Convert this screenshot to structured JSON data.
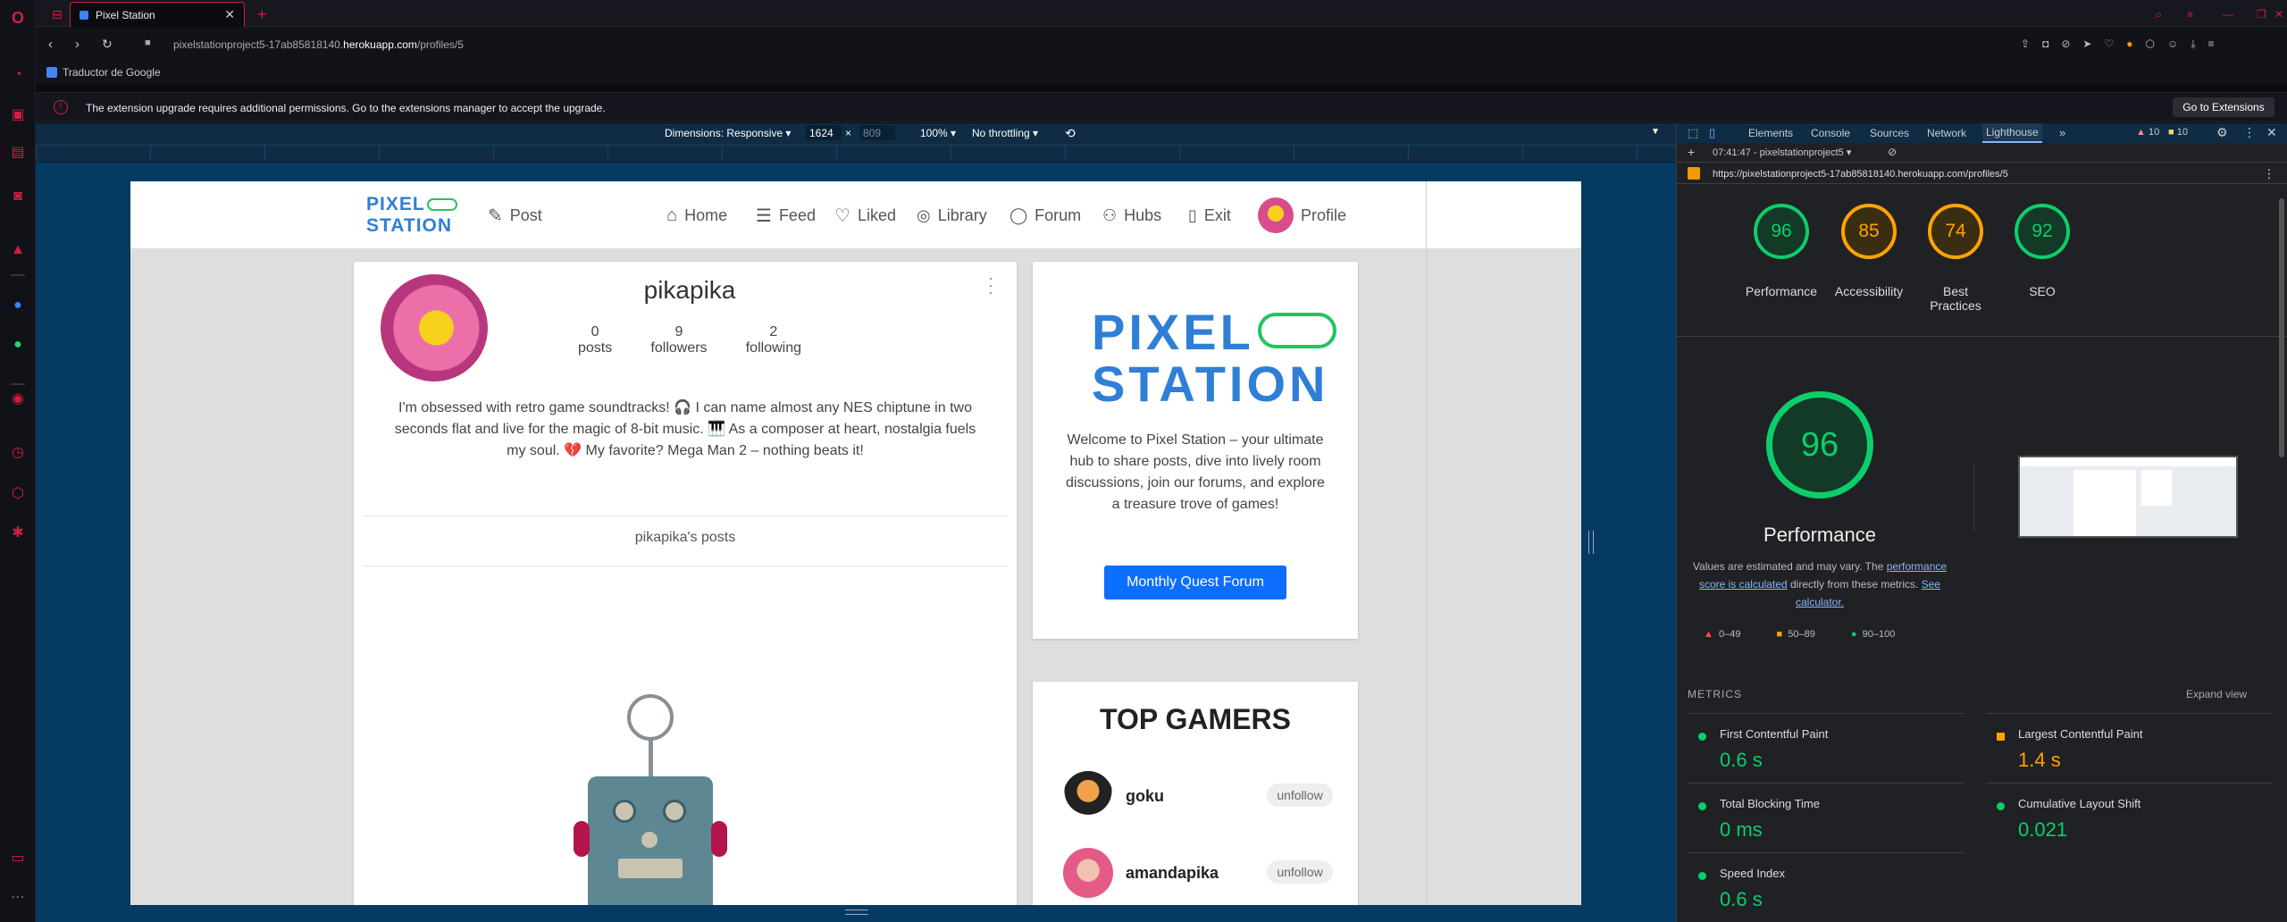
{
  "browser": {
    "tab_title": "Pixel Station",
    "url_prefix": "pixelstationproject5-17ab85818140.",
    "url_domain": "herokuapp.com",
    "url_path": "/profiles/5",
    "bookmark": "Traductor de Google",
    "infobar_text": "The extension upgrade requires additional permissions. Go to the extensions manager to accept the upgrade.",
    "infobar_button": "Go to Extensions"
  },
  "device_toolbar": {
    "dimensions": "Dimensions: Responsive",
    "width": "1624",
    "height": "809",
    "zoom": "100%",
    "throttle": "No throttling"
  },
  "site": {
    "logo_line1": "PIXEL",
    "logo_line2": "STATION",
    "nav": {
      "post": "Post",
      "home": "Home",
      "feed": "Feed",
      "liked": "Liked",
      "library": "Library",
      "forum": "Forum",
      "hubs": "Hubs",
      "exit": "Exit",
      "profile": "Profile"
    },
    "profile": {
      "username": "pikapika",
      "posts_count": "0",
      "posts_label": "posts",
      "followers_count": "9",
      "followers_label": "followers",
      "following_count": "2",
      "following_label": "following",
      "bio": "I'm obsessed with retro game soundtracks! 🎧 I can name almost any NES chiptune in two seconds flat and live for the magic of 8-bit music. 🎹 As a composer at heart, nostalgia fuels my soul. 💔 My favorite? Mega Man 2 – nothing beats it!",
      "posts_heading": "pikapika's posts"
    },
    "welcome": {
      "logo_line1": "PIXEL",
      "logo_line2": "STATION",
      "text": "Welcome to Pixel Station – your ultimate hub to share posts, dive into lively room discussions, join our forums, and explore a treasure trove of games!",
      "button": "Monthly Quest Forum"
    },
    "top_gamers": {
      "title": "TOP GAMERS",
      "gamers": [
        {
          "name": "goku",
          "action": "unfollow"
        },
        {
          "name": "amandapika",
          "action": "unfollow"
        }
      ]
    }
  },
  "devtools": {
    "tabs": [
      "Elements",
      "Console",
      "Sources",
      "Network",
      "Lighthouse"
    ],
    "warnings": "10",
    "issues": "10",
    "report_label": "07:41:47 - pixelstationproject5",
    "report_url": "https://pixelstationproject5-17ab85818140.herokuapp.com/profiles/5",
    "scores": [
      {
        "label": "Performance",
        "value": "96",
        "color": "#0cce6b"
      },
      {
        "label": "Accessibility",
        "value": "85",
        "color": "#ffa400"
      },
      {
        "label": "Best Practices",
        "value": "74",
        "color": "#ffa400"
      },
      {
        "label": "SEO",
        "value": "92",
        "color": "#0cce6b"
      }
    ],
    "big_score": "96",
    "big_label": "Performance",
    "note_a": "Values are estimated and may vary. The ",
    "note_link1": "performance score is calculated",
    "note_b": " directly from these metrics. ",
    "note_link2": "See calculator.",
    "legend": [
      "0–49",
      "50–89",
      "90–100"
    ],
    "metrics_title": "METRICS",
    "expand_view": "Expand view",
    "metrics": [
      {
        "name": "First Contentful Paint",
        "value": "0.6 s",
        "status": "good"
      },
      {
        "name": "Largest Contentful Paint",
        "value": "1.4 s",
        "status": "average"
      },
      {
        "name": "Total Blocking Time",
        "value": "0 ms",
        "status": "good"
      },
      {
        "name": "Cumulative Layout Shift",
        "value": "0.021",
        "status": "good"
      },
      {
        "name": "Speed Index",
        "value": "0.6 s",
        "status": "good"
      }
    ]
  }
}
